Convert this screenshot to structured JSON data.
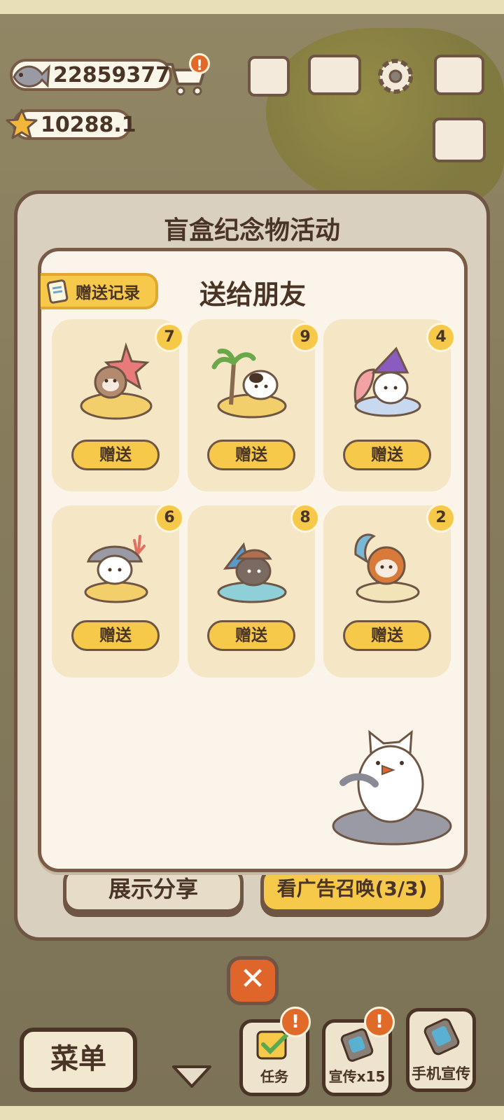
{
  "currency": {
    "fish_amount": "22859377",
    "star_amount": "10288.1",
    "cart_badge": "!"
  },
  "outer_panel": {
    "title": "盲盒纪念物活动",
    "share_label": "展示分享",
    "ad_label": "看广告召唤(3/3)"
  },
  "dialog": {
    "title": "送给朋友",
    "record_label": "赠送记录",
    "items": [
      {
        "count": "7",
        "button": "赠送",
        "theme": "coral-seal-cat"
      },
      {
        "count": "9",
        "button": "赠送",
        "theme": "palm-island-cat"
      },
      {
        "count": "4",
        "button": "赠送",
        "theme": "wizard-shell-cat"
      },
      {
        "count": "6",
        "button": "赠送",
        "theme": "shark-hood-cat"
      },
      {
        "count": "8",
        "button": "赠送",
        "theme": "pirate-cat"
      },
      {
        "count": "2",
        "button": "赠送",
        "theme": "crab-hood-cat"
      }
    ]
  },
  "bottom_bar": {
    "menu_label": "菜单",
    "task_label": "任务",
    "promo_label": "宣传x15",
    "phone_promo_label": "手机宣传",
    "alert_badge": "!"
  },
  "colors": {
    "accent_yellow": "#f6c94a",
    "outline_brown": "#6e5544",
    "close_orange": "#e0652a",
    "card_bg": "#f5e6c6"
  }
}
